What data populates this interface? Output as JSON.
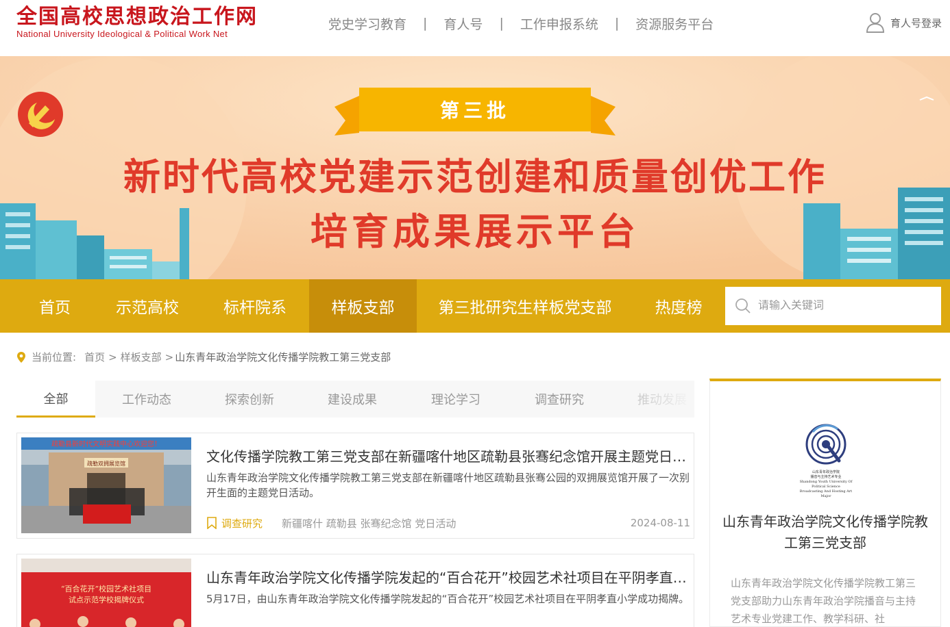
{
  "header": {
    "logo_cn": "全国高校思想政治工作网",
    "logo_en": "National University Ideological & Political Work Net",
    "nav": [
      "党史学习教育",
      "育人号",
      "工作申报系统",
      "资源服务平台"
    ],
    "nav_separator": "|",
    "login_label": "育人号登录"
  },
  "banner": {
    "ribbon": "第三批",
    "line1": "新时代高校党建示范创建和质量创优工作",
    "line2": "培育成果展示平台"
  },
  "mainnav": {
    "items": [
      "首页",
      "示范高校",
      "标杆院系",
      "样板支部",
      "第三批研究生样板党支部",
      "热度榜"
    ],
    "active_index": 3,
    "search_placeholder": "请输入关键词"
  },
  "breadcrumb": {
    "label": "当前位置:",
    "items": [
      "首页",
      "样板支部",
      "山东青年政治学院文化传播学院教工第三党支部"
    ],
    "separator": ">"
  },
  "tabs": {
    "items": [
      "全部",
      "工作动态",
      "探索创新",
      "建设成果",
      "理论学习",
      "调查研究",
      "推动发展"
    ],
    "active_index": 0
  },
  "articles": [
    {
      "title": "文化传播学院教工第三党支部在新疆喀什地区疏勒县张骞纪念馆开展主题党日活动",
      "summary": "山东青年政治学院文化传播学院教工第三党支部在新疆喀什地区疏勒县张骞公园的双拥展览馆开展了一次别开生面的主题党日活动。",
      "category": "调查研究",
      "tags": "新疆喀什 疏勒县 张骞纪念馆 党日活动",
      "date": "2024-08-11",
      "photo_banner": "疏勒县新时代文明实践中心欢迎您！",
      "photo_sign": "疏勒双拥展览馆"
    },
    {
      "title": "山东青年政治学院文化传播学院发起的“百合花开”校园艺术社项目在平阴孝直小学成功揭牌",
      "summary": "5月17日，由山东青年政治学院文化传播学院发起的“百合花开”校园艺术社项目在平阴孝直小学成功揭牌。",
      "photo_line1": "“百合花开”校园艺术社项目",
      "photo_line2": "试点示范学校揭牌仪式"
    }
  ],
  "sidebar": {
    "name": "山东青年政治学院文化传播学院教工第三党支部",
    "description": "山东青年政治学院文化传播学院教工第三党支部助力山东青年政治学院播音与主持艺术专业党建工作、教学科研、社",
    "logo_cn1": "山东青年政治学院",
    "logo_cn2": "播音与主持艺术专业",
    "logo_en1": "Shandong Youth University Of Political Science",
    "logo_en2": "Broadcasting And Hosting Art Major"
  },
  "colors": {
    "brand_red": "#c8161d",
    "nav_gold": "#deaa10",
    "nav_active": "#c78e0a",
    "banner_bg": "#f9d2ae",
    "ribbon": "#f7b500"
  }
}
